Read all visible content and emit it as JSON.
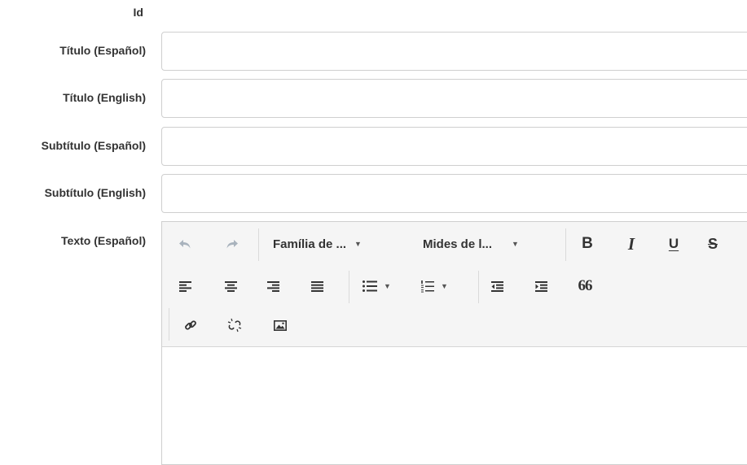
{
  "form": {
    "id_label": "Id",
    "titulo_es_label": "Título (Español)",
    "titulo_en_label": "Título (English)",
    "subtitulo_es_label": "Subtítulo (Español)",
    "subtitulo_en_label": "Subtítulo (English)",
    "texto_es_label": "Texto (Español)"
  },
  "editor": {
    "font_family_dropdown": "Família de ...",
    "font_size_dropdown": "Mides de l...",
    "bold": "B",
    "italic": "I",
    "underline": "U",
    "strikethrough": "S",
    "blockquote": "66",
    "icons": [
      "undo-icon",
      "redo-icon",
      "align-left-icon",
      "align-center-icon",
      "align-right-icon",
      "align-justify-icon",
      "bullet-list-icon",
      "numbered-list-icon",
      "outdent-icon",
      "indent-icon",
      "blockquote-icon",
      "link-icon",
      "unlink-icon",
      "image-icon"
    ]
  }
}
